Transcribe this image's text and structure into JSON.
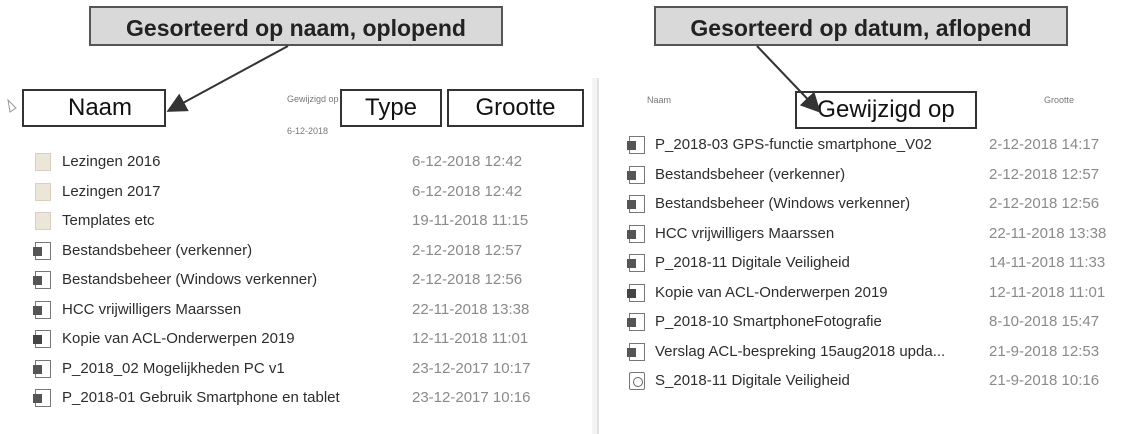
{
  "banners": {
    "left": "Gesorteerd op naam, oplopend",
    "right": "Gesorteerd op datum, aflopend"
  },
  "left_pane": {
    "small_header_modified": "Gewijzigd op",
    "small_header_date": "6-12-2018",
    "callout_name": "Naam",
    "callout_type": "Type",
    "callout_size": "Grootte",
    "rows": [
      {
        "icon": "folder-icon",
        "name": "Lezingen 2016",
        "date": "6-12-2018 12:42"
      },
      {
        "icon": "folder-icon",
        "name": "Lezingen 2017",
        "date": "6-12-2018 12:42"
      },
      {
        "icon": "folder-icon",
        "name": "Templates etc",
        "date": "19-11-2018 11:15"
      },
      {
        "icon": "powerpoint-icon",
        "name": "Bestandsbeheer (verkenner)",
        "date": "2-12-2018 12:57"
      },
      {
        "icon": "word-icon",
        "name": "Bestandsbeheer (Windows verkenner)",
        "date": "2-12-2018 12:56"
      },
      {
        "icon": "word-icon",
        "name": "HCC vrijwilligers Maarssen",
        "date": "22-11-2018 13:38"
      },
      {
        "icon": "excel-icon",
        "name": "Kopie van ACL-Onderwerpen 2019",
        "date": "12-11-2018 11:01"
      },
      {
        "icon": "powerpoint-icon",
        "name": "P_2018_02 Mogelijkheden PC v1",
        "date": "23-12-2017 10:17"
      },
      {
        "icon": "powerpoint-icon",
        "name": "P_2018-01 Gebruik Smartphone en tablet",
        "date": "23-12-2017 10:16"
      }
    ]
  },
  "right_pane": {
    "small_header_name": "Naam",
    "small_header_size": "Grootte",
    "callout_modified": "Gewijzigd op",
    "rows": [
      {
        "icon": "powerpoint-icon",
        "name": "P_2018-03 GPS-functie smartphone_V02",
        "date": "2-12-2018 14:17"
      },
      {
        "icon": "powerpoint-icon",
        "name": "Bestandsbeheer (verkenner)",
        "date": "2-12-2018 12:57"
      },
      {
        "icon": "word-icon",
        "name": "Bestandsbeheer (Windows verkenner)",
        "date": "2-12-2018 12:56"
      },
      {
        "icon": "word-icon",
        "name": "HCC vrijwilligers Maarssen",
        "date": "22-11-2018 13:38"
      },
      {
        "icon": "powerpoint-icon",
        "name": "P_2018-11 Digitale Veiligheid",
        "date": "14-11-2018 11:33"
      },
      {
        "icon": "excel-icon",
        "name": "Kopie van ACL-Onderwerpen 2019",
        "date": "12-11-2018 11:01"
      },
      {
        "icon": "powerpoint-icon",
        "name": "P_2018-10 SmartphoneFotografie",
        "date": "8-10-2018 15:47"
      },
      {
        "icon": "word-icon",
        "name": "Verslag ACL-bespreking 15aug2018 upda...",
        "date": "21-9-2018 12:53"
      },
      {
        "icon": "pdf-icon",
        "name": "S_2018-11 Digitale Veiligheid",
        "date": "21-9-2018 10:16"
      }
    ]
  }
}
